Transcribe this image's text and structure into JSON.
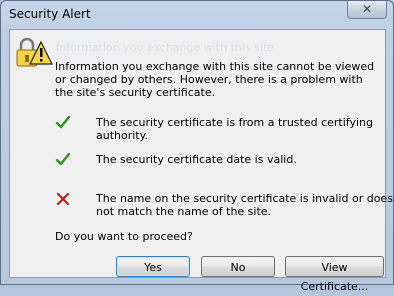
{
  "window": {
    "title": "Security Alert",
    "close_glyph": "✕"
  },
  "ghost_text": "Information you exchange with this site",
  "message": "Information you exchange with this site cannot be viewed or changed by others. However, there is a problem with the site's security certificate.",
  "checks": [
    {
      "status": "ok",
      "icon": "green-checkmark-icon",
      "text": "The security certificate is from a trusted certifying authority."
    },
    {
      "status": "ok",
      "icon": "green-checkmark-icon",
      "text": "The security certificate date is valid."
    },
    {
      "status": "error",
      "icon": "red-x-icon",
      "text": "The name on the security certificate is invalid or does not match the name of the site."
    }
  ],
  "question": "Do you want to proceed?",
  "buttons": {
    "yes": "Yes",
    "no": "No",
    "view_certificate": "View Certificate..."
  },
  "colors": {
    "check_green": "#3a8f2a",
    "error_red": "#a8262b",
    "padlock_yellow": "#f6d34a"
  }
}
